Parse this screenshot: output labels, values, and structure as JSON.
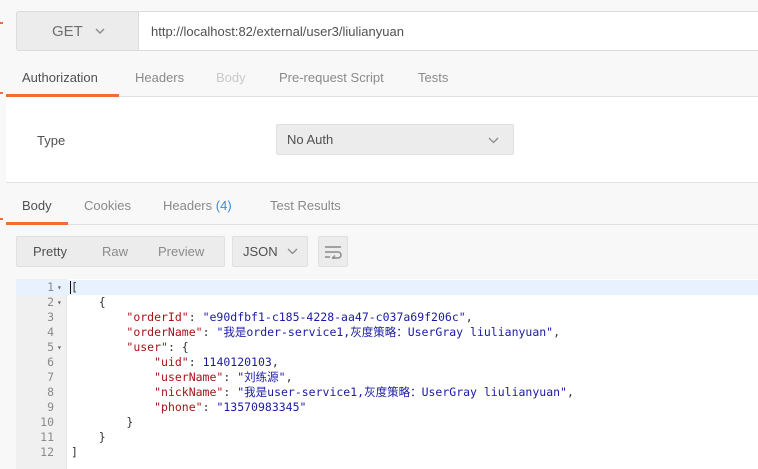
{
  "request": {
    "method": "GET",
    "url": "http://localhost:82/external/user3/liulianyuan"
  },
  "request_tabs": [
    {
      "label": "Authorization",
      "state": "active"
    },
    {
      "label": "Headers",
      "state": "normal"
    },
    {
      "label": "Body",
      "state": "disabled"
    },
    {
      "label": "Pre-request Script",
      "state": "normal"
    },
    {
      "label": "Tests",
      "state": "normal"
    }
  ],
  "auth": {
    "type_label": "Type",
    "type_value": "No Auth"
  },
  "response_tabs": [
    {
      "label": "Body",
      "state": "active"
    },
    {
      "label": "Cookies",
      "state": "normal"
    },
    {
      "label": "Headers",
      "count": "(4)",
      "state": "normal"
    },
    {
      "label": "Test Results",
      "state": "normal"
    }
  ],
  "view_modes": [
    {
      "label": "Pretty",
      "state": "active"
    },
    {
      "label": "Raw",
      "state": "normal"
    },
    {
      "label": "Preview",
      "state": "normal"
    }
  ],
  "format": "JSON",
  "code_lines": [
    {
      "num": "1",
      "fold": true,
      "text": "["
    },
    {
      "num": "2",
      "fold": true,
      "text": "    {"
    },
    {
      "num": "3",
      "fold": false,
      "text": "        \"orderId\": \"e90dfbf1-c185-4228-aa47-c037a69f206c\","
    },
    {
      "num": "4",
      "fold": false,
      "text": "        \"orderName\": \"我是order-service1,灰度策略：UserGray liulianyuan\","
    },
    {
      "num": "5",
      "fold": true,
      "text": "        \"user\": {"
    },
    {
      "num": "6",
      "fold": false,
      "text": "            \"uid\": 1140120103,"
    },
    {
      "num": "7",
      "fold": false,
      "text": "            \"userName\": \"刘练源\","
    },
    {
      "num": "8",
      "fold": false,
      "text": "            \"nickName\": \"我是user-service1,灰度策略：UserGray liulianyuan\","
    },
    {
      "num": "9",
      "fold": false,
      "text": "            \"phone\": \"13570983345\""
    },
    {
      "num": "10",
      "fold": false,
      "text": "        }"
    },
    {
      "num": "11",
      "fold": false,
      "text": "    }"
    },
    {
      "num": "12",
      "fold": false,
      "text": "]"
    }
  ],
  "colors": {
    "accent": "#f26b3a",
    "json_key": "#a31515",
    "json_value": "#1a1aa6",
    "header_count": "#3f8ad6"
  }
}
